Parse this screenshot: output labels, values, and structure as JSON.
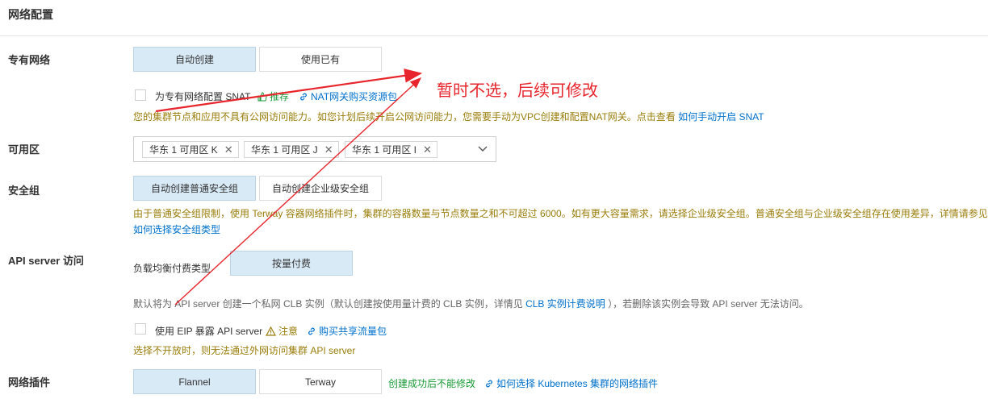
{
  "section": {
    "title": "网络配置"
  },
  "vpc": {
    "label": "专有网络",
    "auto_create": "自动创建",
    "use_existing": "使用已有",
    "snat_label": "为专有网络配置 SNAT",
    "recommend": "推荐",
    "nat_link": "NAT网关购买资源包",
    "notice_text": "您的集群节点和应用不具有公网访问能力。如您计划后续开启公网访问能力，您需要手动为VPC创建和配置NAT网关。点击查看",
    "notice_link": "如何手动开启 SNAT"
  },
  "zone": {
    "label": "可用区",
    "tags": [
      "华东 1 可用区 K",
      "华东 1 可用区 J",
      "华东 1 可用区 I"
    ]
  },
  "security_group": {
    "label": "安全组",
    "normal": "自动创建普通安全组",
    "enterprise": "自动创建企业级安全组",
    "notice_text": "由于普通安全组限制，使用 Terway 容器网络插件时，集群的容器数量与节点数量之和不可超过 6000。如有更大容量需求，请选择企业级安全组。普通安全组与企业级安全组存在使用差异，详情请参见",
    "notice_link": "如何选择安全组类型"
  },
  "api_server": {
    "label": "API server 访问",
    "billing_label": "负载均衡付费类型",
    "billing_value": "按量付费",
    "desc_pre": "默认将为 API server 创建一个私网 CLB 实例（默认创建按使用量计费的 CLB 实例，详情见",
    "desc_link": "CLB 实例计费说明",
    "desc_post": "），若删除该实例会导致 API server 无法访问。",
    "eip_label": "使用 EIP 暴露 API server",
    "attention": "注意",
    "buy_link": "购买共享流量包",
    "eip_notice": "选择不开放时，则无法通过外网访问集群 API server"
  },
  "network_plugin": {
    "label": "网络插件",
    "flannel": "Flannel",
    "terway": "Terway",
    "notice": "创建成功后不能修改",
    "link": "如何选择 Kubernetes 集群的网络插件"
  },
  "annotation": {
    "text": "暂时不选，后续可修改"
  },
  "colors": {
    "active_bg": "#d9eaf7",
    "link": "#0070cc",
    "warning": "#9a7d0a",
    "green": "#1a9a36",
    "annotation_red": "#e8252c"
  }
}
